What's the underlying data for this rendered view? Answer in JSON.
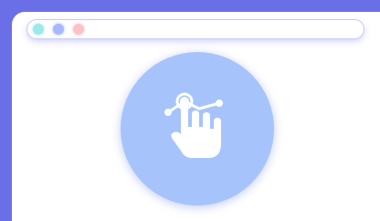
{
  "window": {
    "controls": [
      "dot-teal",
      "dot-blue",
      "dot-pink"
    ]
  },
  "hero": {
    "icon": "touch-hand-gesture-icon"
  },
  "colors": {
    "background": "#6a6fe8",
    "window": "#ffffff",
    "circle": "#a6c4fb",
    "dot_teal": "#9fe8e8",
    "dot_blue": "#a9b7ff",
    "dot_pink": "#ffc1c8"
  }
}
